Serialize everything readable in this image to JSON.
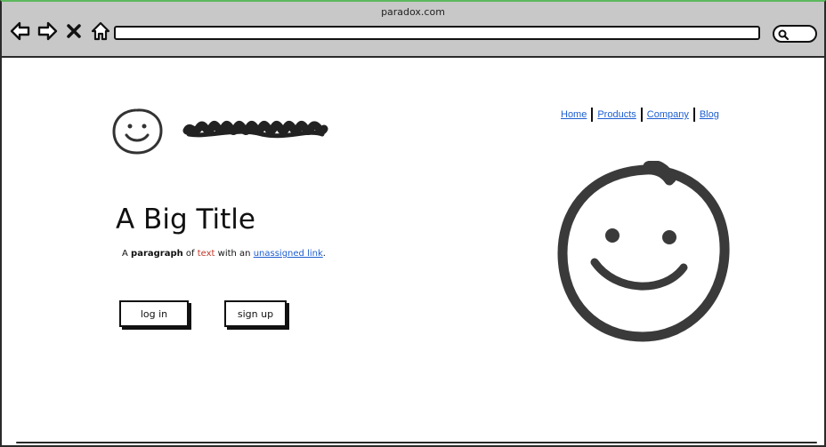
{
  "browser": {
    "url_title": "paradox.com",
    "address_value": "",
    "nav_icons": [
      "back-arrow-icon",
      "forward-arrow-icon",
      "close-x-icon",
      "home-icon"
    ],
    "search_icon": "search-icon"
  },
  "header": {
    "logo_icon": "smiley-face-icon",
    "logo_text_scribble": "scribbled-logo-text",
    "nav_links": [
      "Home",
      "Products",
      "Company",
      "Blog"
    ],
    "link_color": "#1e5fd1"
  },
  "main": {
    "title": "A Big Title",
    "paragraph": {
      "part1": "A ",
      "bold": "paragraph",
      "part2": " of ",
      "colored": "text",
      "part3": " with an ",
      "link": "unassigned link",
      "part4": "."
    },
    "buttons": {
      "login": "log in",
      "signup": "sign up"
    },
    "hero_image_icon": "large-smiley-face-icon"
  }
}
